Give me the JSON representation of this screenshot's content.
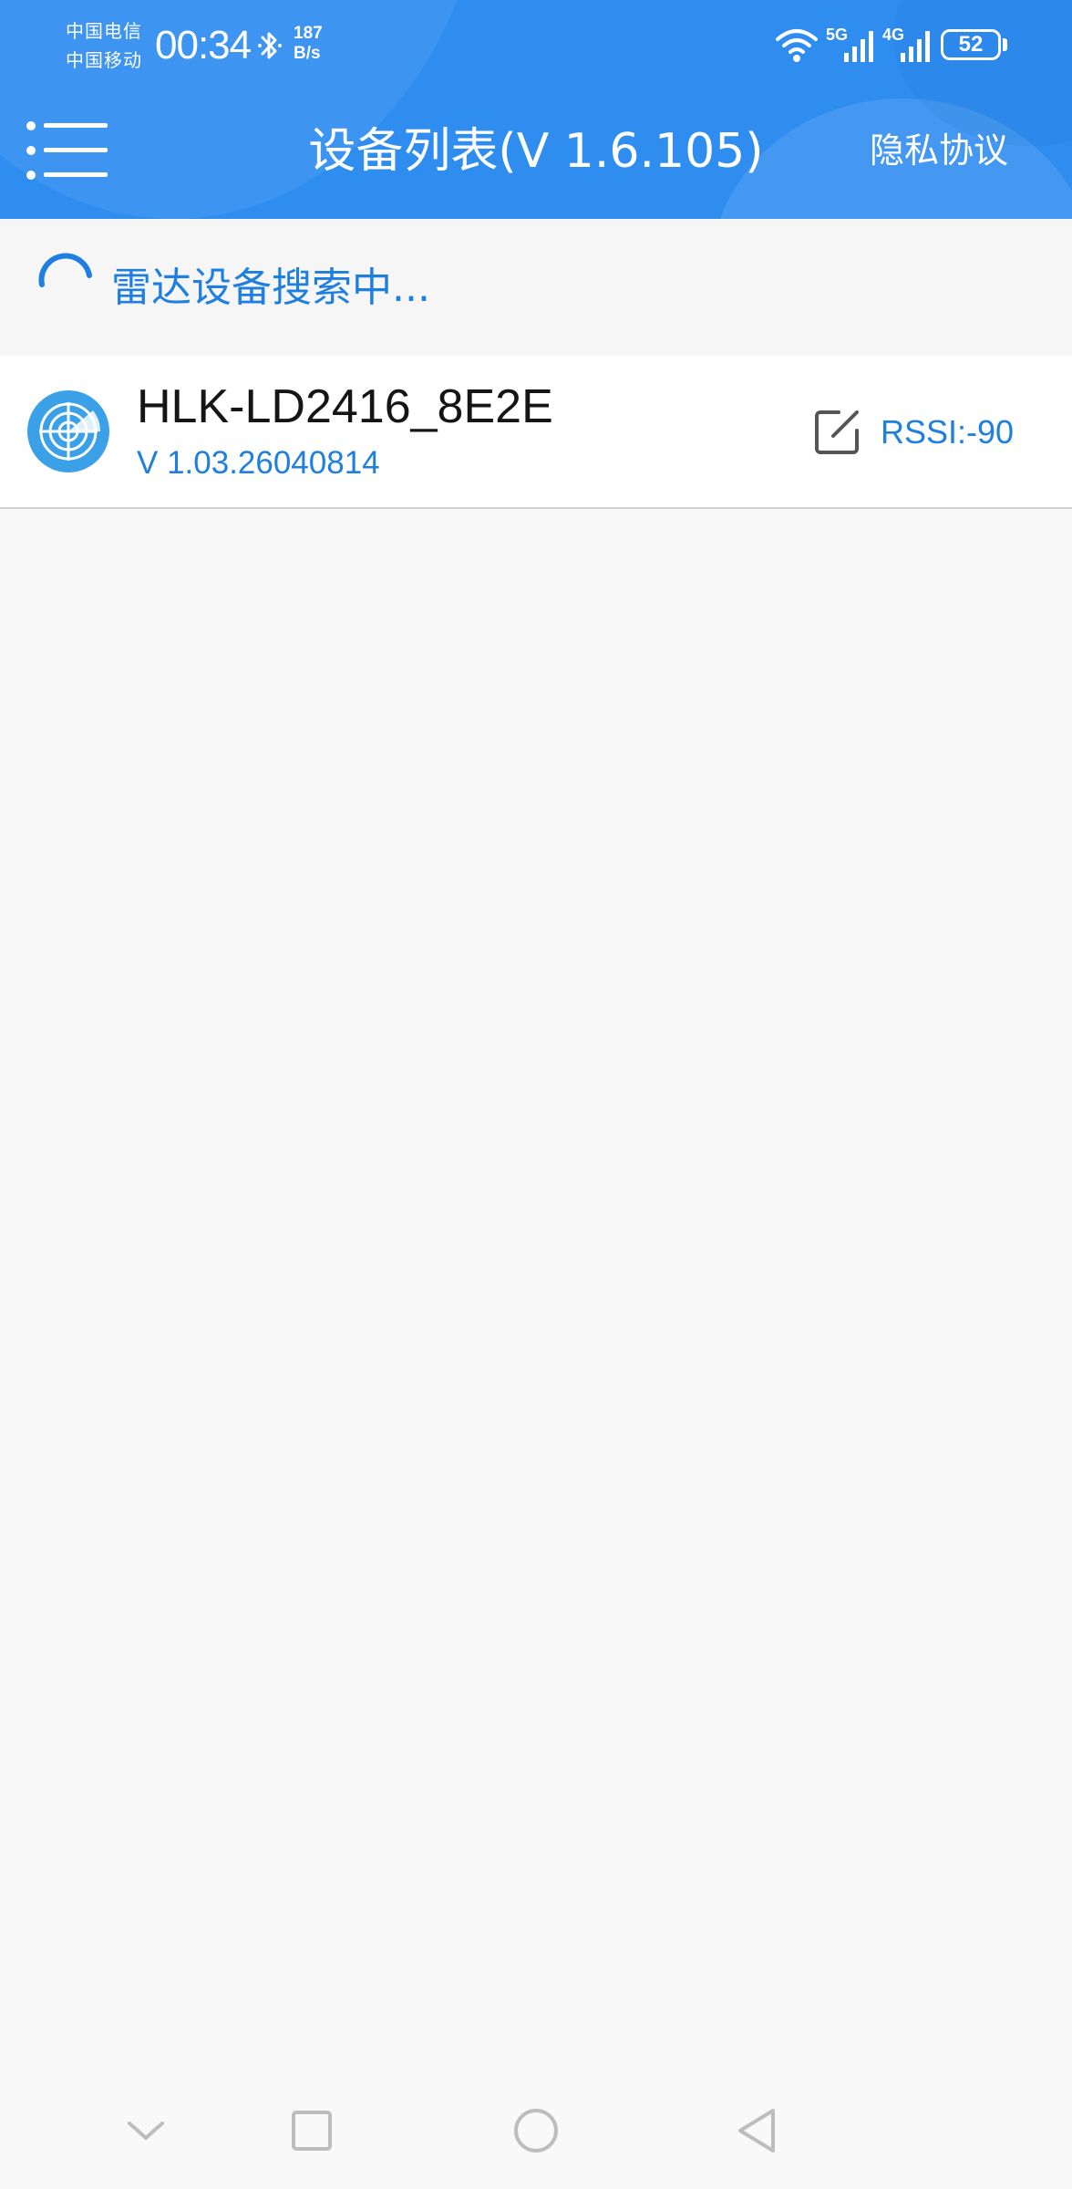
{
  "status_bar": {
    "carrier_1": "中国电信",
    "carrier_2": "中国移动",
    "time": "00:34",
    "net_speed_value": "187",
    "net_speed_unit": "B/s",
    "signal_1_label": "5G",
    "signal_2_label": "4G",
    "battery_level": "52",
    "icons": [
      "bluetooth-icon",
      "wifi-icon",
      "signal-bars-icon",
      "battery-icon"
    ]
  },
  "toolbar": {
    "menu_icon": "list-menu-icon",
    "title": "设备列表(V 1.6.105)",
    "privacy_label": "隐私协议"
  },
  "scan": {
    "status_text": "雷达设备搜索中..."
  },
  "devices": [
    {
      "name": "HLK-LD2416_8E2E",
      "version": "V 1.03.26040814",
      "rssi": "RSSI:-90",
      "icon": "radar-icon",
      "action_icon": "edit-icon"
    }
  ],
  "nav": {
    "icons": [
      "chevron-down-icon",
      "recents-square-icon",
      "home-circle-icon",
      "back-triangle-icon"
    ]
  },
  "colors": {
    "header_bg": "#2f8df0",
    "accent_text": "#1e7fe0",
    "device_icon_bg": "#3aa0e8",
    "page_bg": "#f9f9f9"
  }
}
